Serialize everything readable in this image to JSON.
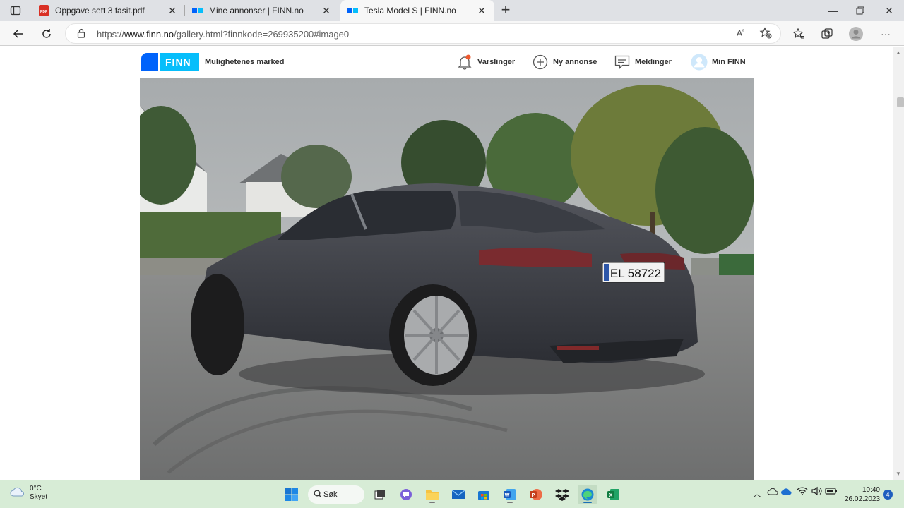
{
  "browser": {
    "tabs": [
      {
        "label": "Oppgave sett 3 fasit.pdf",
        "icon": "pdf-icon"
      },
      {
        "label": "Mine annonser | FINN.no",
        "icon": "finn-favicon-icon"
      },
      {
        "label": "Tesla Model S | FINN.no",
        "icon": "finn-favicon-icon",
        "active": true
      }
    ],
    "url": {
      "scheme": "https://",
      "host": "www.finn.no",
      "path": "/gallery.html?finnkode=269935200#image0"
    }
  },
  "finn": {
    "logo_text": "FINN",
    "slogan": "Mulighetenes marked",
    "nav": {
      "notifications": "Varslinger",
      "new_ad": "Ny annonse",
      "messages": "Meldinger",
      "my_finn": "Min FINN"
    },
    "colors": {
      "brand_blue": "#0063fb",
      "brand_light": "#06befb"
    }
  },
  "gallery": {
    "photo_subject": "Tesla Model S",
    "plate": "EL 58722"
  },
  "taskbar": {
    "weather_temp": "0°C",
    "weather_desc": "Skyet",
    "search_label": "Søk",
    "time": "10:40",
    "date": "26.02.2023",
    "notification_count": "4"
  }
}
